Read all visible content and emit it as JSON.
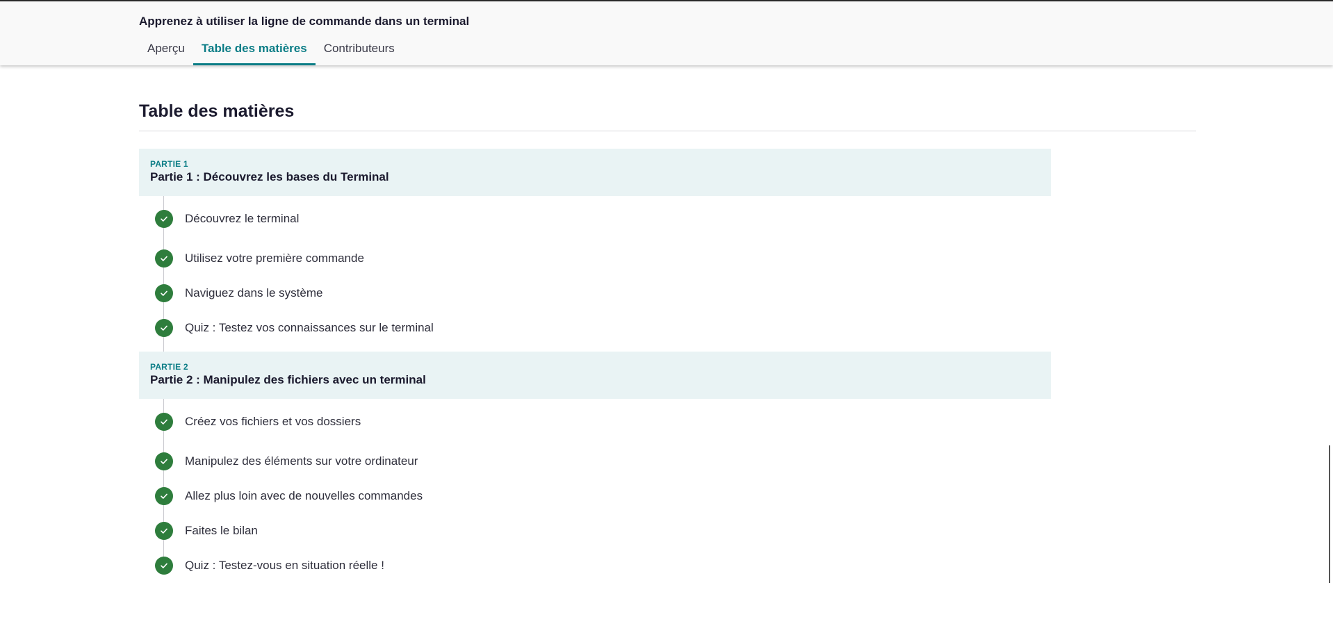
{
  "header": {
    "course_title": "Apprenez à utiliser la ligne de commande dans un terminal",
    "tabs": [
      {
        "label": "Aperçu"
      },
      {
        "label": "Table des matières"
      },
      {
        "label": "Contributeurs"
      }
    ],
    "active_tab": "Table des matières"
  },
  "main": {
    "title": "Table des matières",
    "parts": [
      {
        "eyebrow": "PARTIE 1",
        "title": "Partie 1 :  Découvrez les bases du Terminal",
        "chapters": [
          {
            "label": "Découvrez le terminal",
            "status_icon": "check-circle-icon"
          },
          {
            "label": "Utilisez votre première commande",
            "status_icon": "check-circle-icon"
          },
          {
            "label": "Naviguez dans le système",
            "status_icon": "check-circle-icon"
          },
          {
            "label": "Quiz : Testez vos connaissances sur le terminal",
            "status_icon": "check-circle-icon"
          }
        ]
      },
      {
        "eyebrow": "PARTIE 2",
        "title": "Partie 2 : Manipulez des fichiers avec un terminal",
        "chapters": [
          {
            "label": "Créez vos fichiers et vos dossiers",
            "status_icon": "check-circle-icon"
          },
          {
            "label": "Manipulez des éléments sur votre ordinateur",
            "status_icon": "check-circle-icon"
          },
          {
            "label": "Allez plus loin avec de nouvelles commandes",
            "status_icon": "check-circle-icon"
          },
          {
            "label": "Faites le bilan",
            "status_icon": "check-circle-icon"
          },
          {
            "label": "Quiz : Testez-vous en situation réelle !",
            "status_icon": "check-circle-icon"
          }
        ]
      }
    ]
  },
  "colors": {
    "accent": "#0b7d86",
    "completed": "#2e7d3c",
    "part_background": "#e9f3f4",
    "heading": "#1b1a2e"
  }
}
